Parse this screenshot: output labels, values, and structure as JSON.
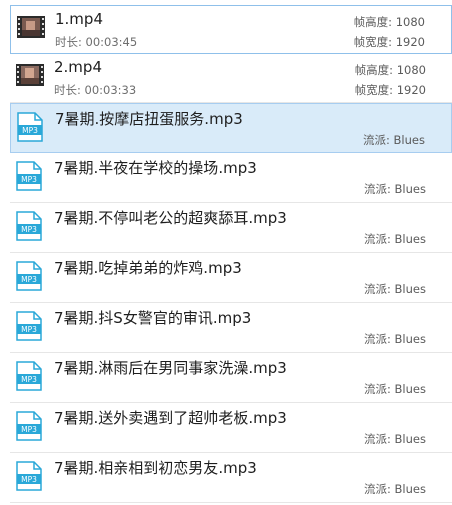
{
  "files": [
    {
      "kind": "video",
      "name": "1.mp4",
      "duration_label": "时长:",
      "duration": "00:03:45",
      "height_label": "帧高度:",
      "height": "1080",
      "width_label": "帧宽度:",
      "width": "1920",
      "icon": "video-thumbnail-icon"
    },
    {
      "kind": "video",
      "name": "2.mp4",
      "duration_label": "时长:",
      "duration": "00:03:33",
      "height_label": "帧高度:",
      "height": "1080",
      "width_label": "帧宽度:",
      "width": "1920",
      "icon": "video-thumbnail-icon"
    },
    {
      "kind": "audio",
      "name": "7暑期.按摩店扭蛋服务.mp3",
      "genre_label": "流派:",
      "genre": "Blues",
      "icon": "mp3-file-icon"
    },
    {
      "kind": "audio",
      "name": "7暑期.半夜在学校的操场.mp3",
      "genre_label": "流派:",
      "genre": "Blues",
      "icon": "mp3-file-icon"
    },
    {
      "kind": "audio",
      "name": "7暑期.不停叫老公的超爽舔耳.mp3",
      "genre_label": "流派:",
      "genre": "Blues",
      "icon": "mp3-file-icon"
    },
    {
      "kind": "audio",
      "name": "7暑期.吃掉弟弟的炸鸡.mp3",
      "genre_label": "流派:",
      "genre": "Blues",
      "icon": "mp3-file-icon"
    },
    {
      "kind": "audio",
      "name": "7暑期.抖S女警官的审讯.mp3",
      "genre_label": "流派:",
      "genre": "Blues",
      "icon": "mp3-file-icon"
    },
    {
      "kind": "audio",
      "name": "7暑期.淋雨后在男同事家洗澡.mp3",
      "genre_label": "流派:",
      "genre": "Blues",
      "icon": "mp3-file-icon"
    },
    {
      "kind": "audio",
      "name": "7暑期.送外卖遇到了超帅老板.mp3",
      "genre_label": "流派:",
      "genre": "Blues",
      "icon": "mp3-file-icon"
    },
    {
      "kind": "audio",
      "name": "7暑期.相亲相到初恋男友.mp3",
      "genre_label": "流派:",
      "genre": "Blues",
      "icon": "mp3-file-icon"
    }
  ],
  "mp3_icon_text": "MP3",
  "colors": {
    "selection_bg": "#d9ebf9",
    "selection_border": "#a7cdf0",
    "mp3_icon": "#2aa8d8"
  }
}
